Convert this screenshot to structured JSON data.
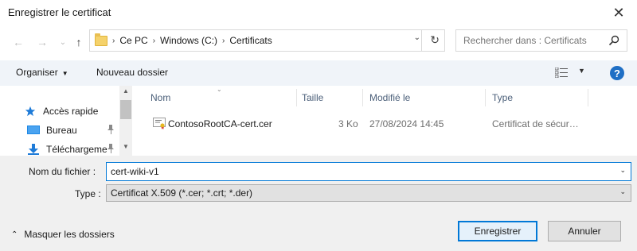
{
  "window": {
    "title": "Enregistrer le certificat",
    "close_glyph": "✕"
  },
  "nav": {
    "back_glyph": "←",
    "forward_glyph": "→",
    "recent_glyph": "⌄",
    "up_glyph": "↑"
  },
  "address": {
    "crumbs": [
      "Ce PC",
      "Windows (C:)",
      "Certificats"
    ],
    "separator": "›",
    "dropdown_glyph": "⌄",
    "refresh_glyph": "↻"
  },
  "search": {
    "placeholder": "Rechercher dans : Certificats"
  },
  "toolbar": {
    "organize": "Organiser",
    "organize_caret": "▼",
    "new_folder": "Nouveau dossier",
    "view_caret": "▼",
    "help_glyph": "?"
  },
  "sidebar": {
    "items": [
      {
        "label": "Accès rapide",
        "icon": "star-icon",
        "pinned": false
      },
      {
        "label": "Bureau",
        "icon": "desktop-icon",
        "pinned": true
      },
      {
        "label": "Téléchargeme",
        "icon": "download-icon",
        "pinned": true
      }
    ],
    "pin_glyph": "📌",
    "scroll_up_glyph": "▲",
    "scroll_down_glyph": "▼"
  },
  "file_list": {
    "columns": [
      "Nom",
      "Taille",
      "Modifié le",
      "Type"
    ],
    "sort_glyph": "⌄",
    "rows": [
      {
        "name": "ContosoRootCA-cert.cer",
        "size": "3 Ko",
        "modified": "27/08/2024 14:45",
        "type": "Certificat de sécur…",
        "icon": "certificate-icon"
      }
    ]
  },
  "form": {
    "filename_label": "Nom du fichier :",
    "filename_value": "cert-wiki-v1",
    "type_label": "Type :",
    "type_value": "Certificat X.509 (*.cer; *.crt; *.der)",
    "caret_glyph": "⌄"
  },
  "footer": {
    "hide_folders": "Masquer les dossiers",
    "hide_glyph": "⌃",
    "save": "Enregistrer",
    "cancel": "Annuler"
  },
  "colors": {
    "accent": "#0078d7",
    "help": "#1f6fc5",
    "toolbar_bg": "#f0f4f9",
    "header_text": "#4c607a"
  }
}
